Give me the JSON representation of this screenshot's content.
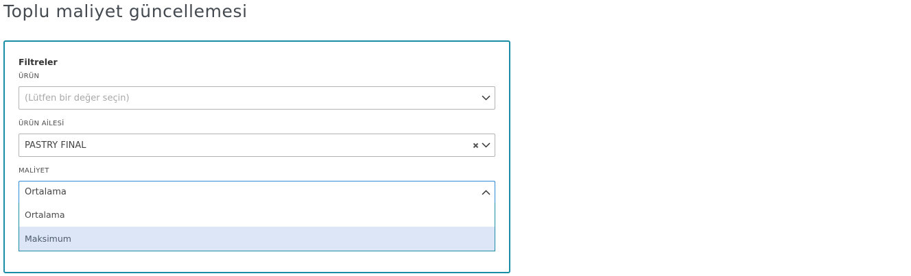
{
  "page": {
    "title": "Toplu maliyet güncellemesi"
  },
  "filters": {
    "heading": "Filtreler",
    "product": {
      "label": "ÜRÜN",
      "placeholder": "(Lütfen bir değer seçin)"
    },
    "product_family": {
      "label": "ÜRÜN AİLESİ",
      "value": "PASTRY FINAL"
    },
    "cost": {
      "label": "MALİYET",
      "value": "Ortalama",
      "options": [
        "Ortalama",
        "Maksimum"
      ],
      "highlighted_option": "Maksimum"
    }
  },
  "colors": {
    "panel_border": "#1a8ca5",
    "focus_border": "#2c8ad8",
    "option_highlight": "#dde6f7"
  },
  "icons": {
    "dropdown": "chevron-down-icon",
    "dropdown_open": "chevron-up-icon",
    "clear": "clear-icon"
  }
}
